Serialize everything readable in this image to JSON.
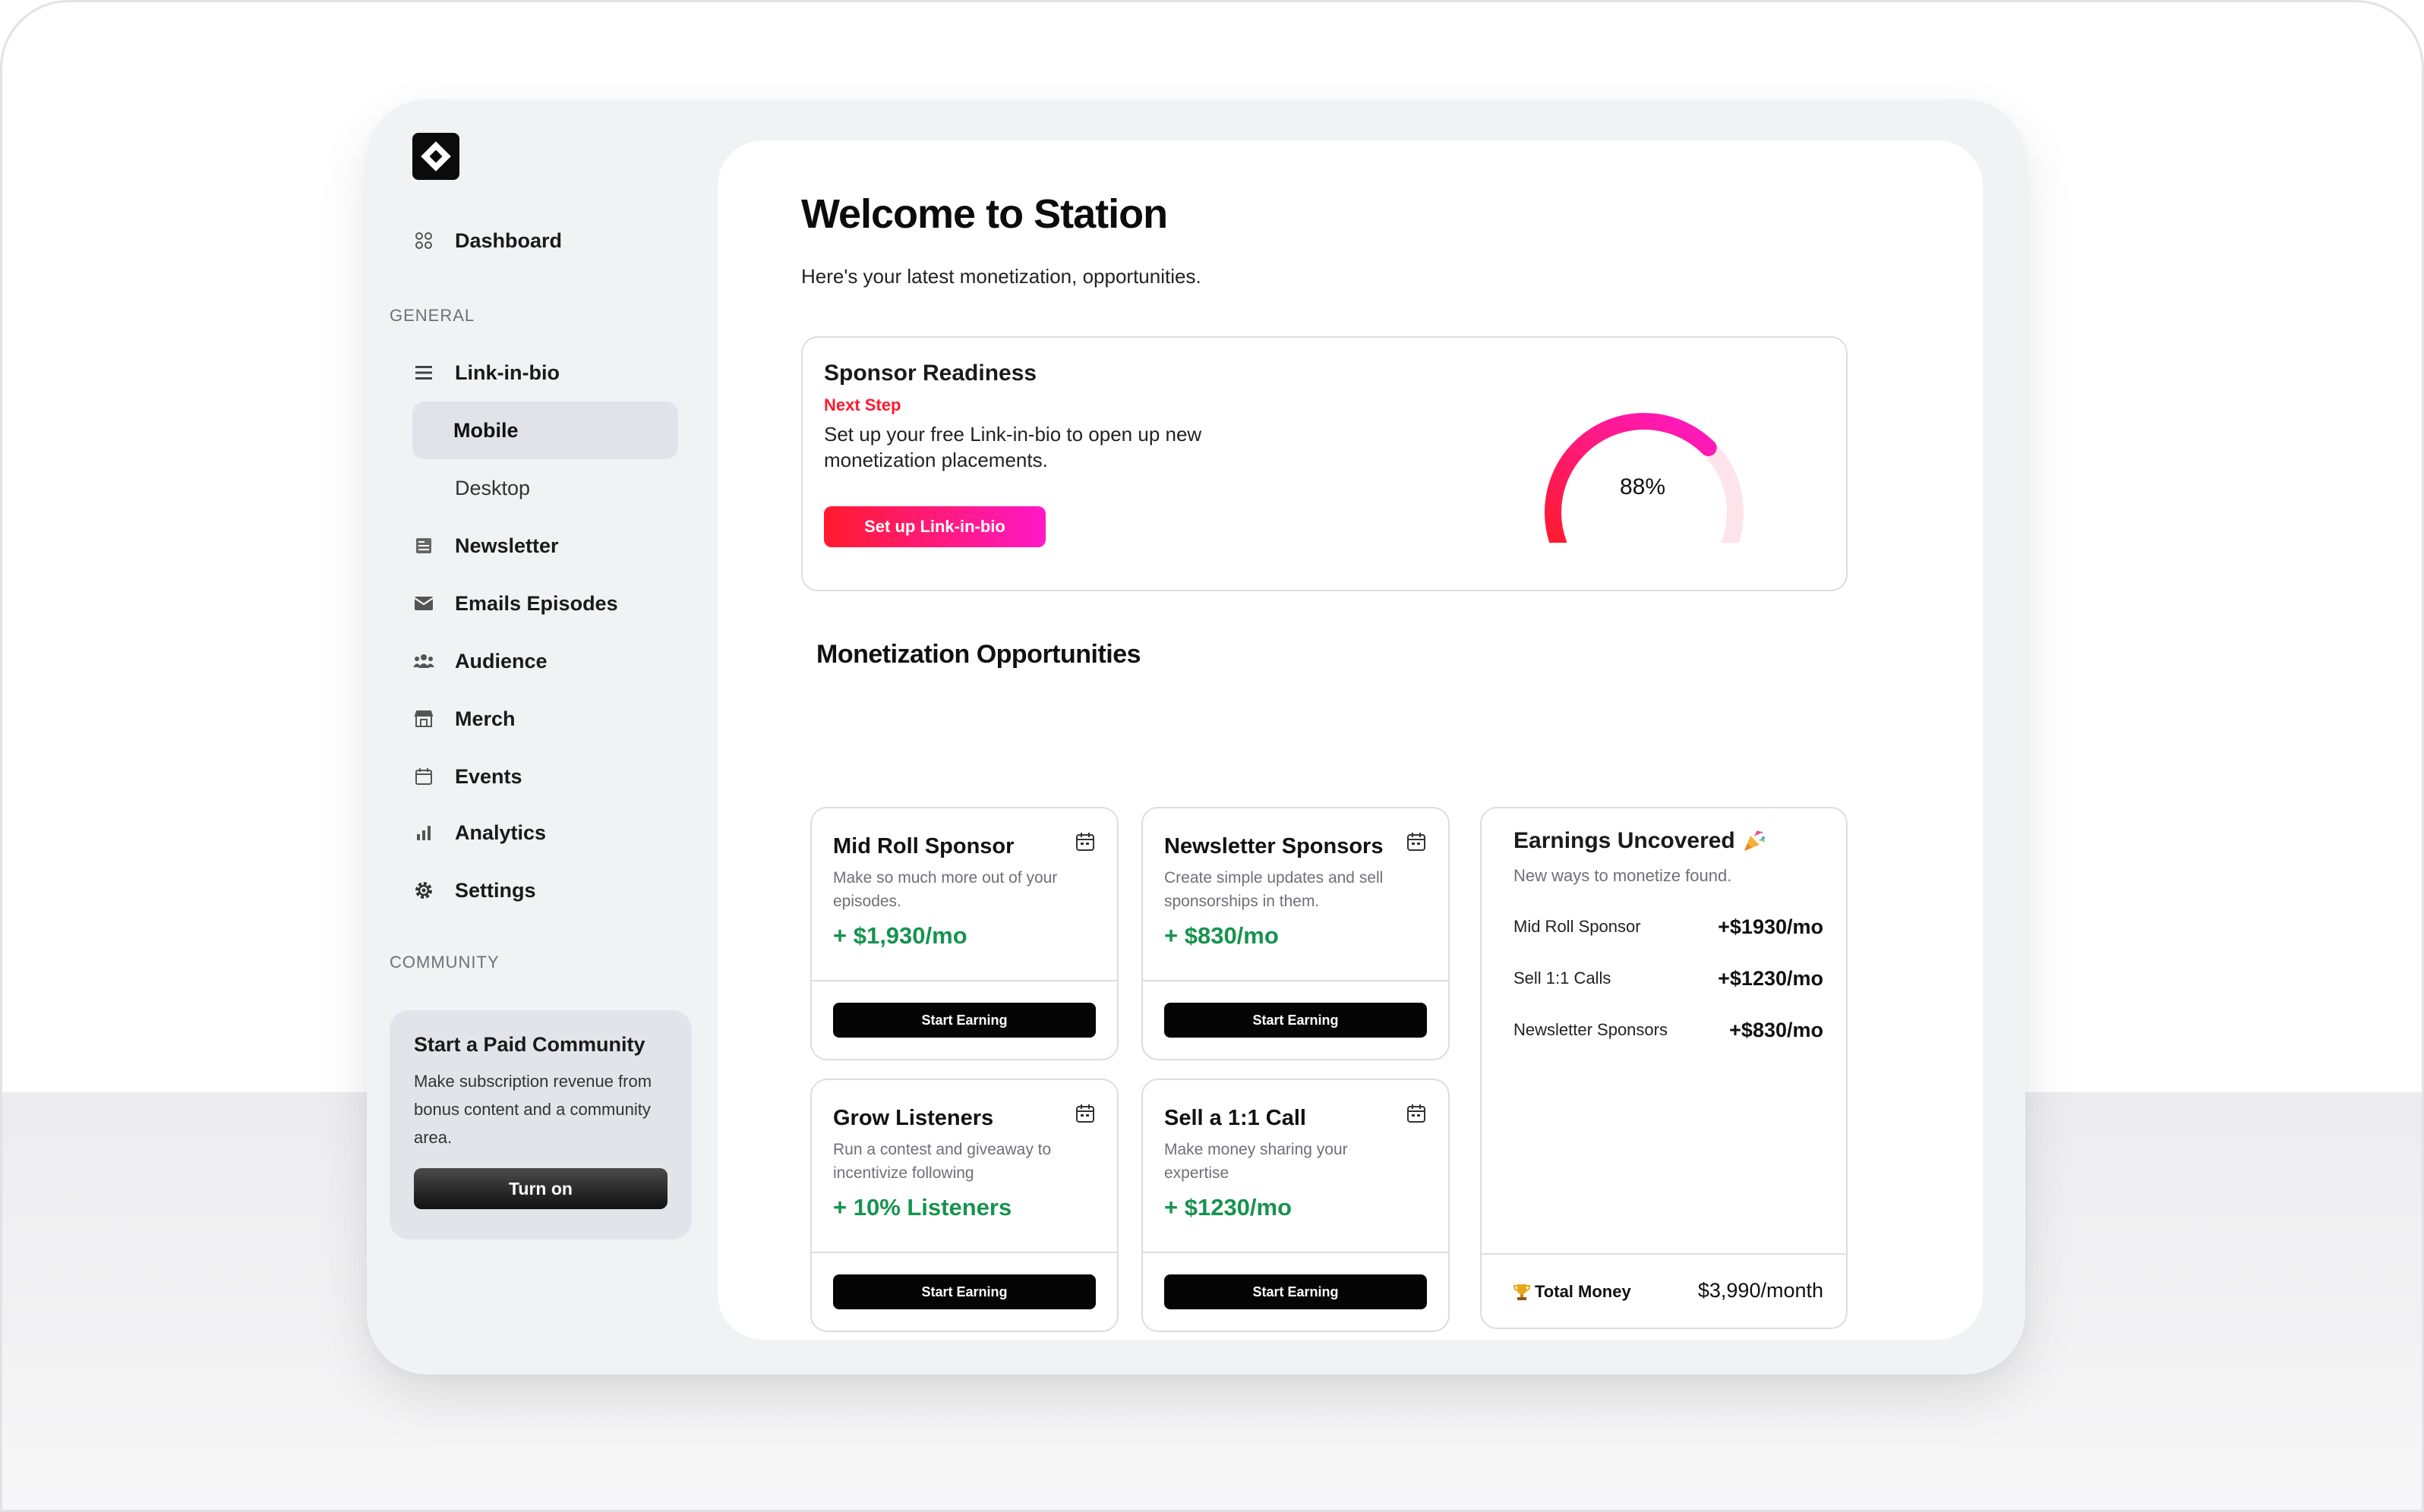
{
  "sidebar": {
    "dashboard": "Dashboard",
    "general_label": "GENERAL",
    "link_in_bio": "Link-in-bio",
    "mobile": "Mobile",
    "desktop": "Desktop",
    "newsletter": "Newsletter",
    "emails_episodes": "Emails Episodes",
    "audience": "Audience",
    "merch": "Merch",
    "events": "Events",
    "analytics": "Analytics",
    "settings": "Settings",
    "community_label": "COMMUNITY",
    "community_card": {
      "title": "Start a Paid Community",
      "description": "Make subscription revenue from bonus content and a community area.",
      "button": "Turn on"
    }
  },
  "main": {
    "title": "Welcome to Station",
    "subtitle": "Here's your latest monetization, opportunities.",
    "readiness": {
      "title": "Sponsor Readiness",
      "next_step": "Next Step",
      "description": "Set up your free Link-in-bio to open up new monetization placements.",
      "button": "Set up Link-in-bio",
      "percent": 88,
      "percent_label": "88%"
    },
    "opportunities_title": "Monetization Opportunities",
    "opportunities": [
      {
        "title": "Mid Roll Sponsor",
        "description": "Make so much more out of your episodes.",
        "amount": "+ $1,930/mo",
        "button": "Start Earning"
      },
      {
        "title": "Newsletter Sponsors",
        "description": "Create simple updates and sell sponsorships in them.",
        "amount": "+ $830/mo",
        "button": "Start Earning"
      },
      {
        "title": "Grow Listeners",
        "description": "Run a contest and giveaway to incentivize following",
        "amount": "+ 10% Listeners",
        "button": "Start Earning"
      },
      {
        "title": "Sell a 1:1 Call",
        "description": "Make money sharing your expertise",
        "amount": "+ $1230/mo",
        "button": "Start Earning"
      }
    ],
    "earnings": {
      "title": "Earnings Uncovered",
      "subtitle": "New ways to monetize found.",
      "rows": [
        {
          "name": "Mid Roll Sponsor",
          "value": "+$1930/mo"
        },
        {
          "name": "Sell 1:1 Calls",
          "value": "+$1230/mo"
        },
        {
          "name": "Newsletter Sponsors",
          "value": "+$830/mo"
        }
      ],
      "total_label": "Total Money",
      "total_value": "$3,990/month"
    }
  },
  "colors": {
    "accent_red": "#ff1a2e",
    "accent_pink": "#ff19c6",
    "positive_green": "#17934f"
  }
}
